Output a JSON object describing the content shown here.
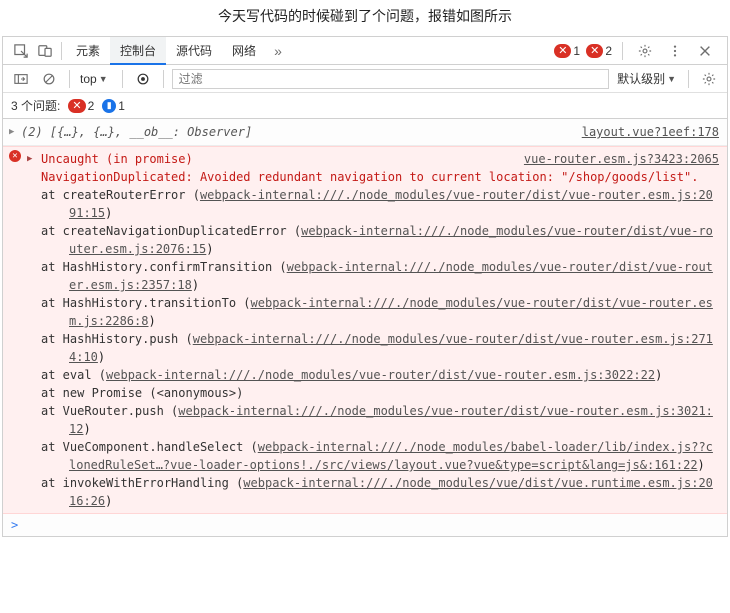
{
  "title": "今天写代码的时候碰到了个问题，报错如图所示",
  "tabs": {
    "elements": "元素",
    "console": "控制台",
    "sources": "源代码",
    "network": "网络"
  },
  "top_badges": {
    "error_count": "1",
    "warn_count": "2"
  },
  "toolbar": {
    "context": "top",
    "filter_placeholder": "过滤",
    "level": "默认级别"
  },
  "issues_bar": {
    "label": "3 个问题:",
    "err_count": "2",
    "msg_count": "1"
  },
  "log1": {
    "text": "(2) [{…}, {…}, __ob__: Observer]",
    "link": "layout.vue?1eef:178"
  },
  "error": {
    "head": "Uncaught (in promise)",
    "head_link": "vue-router.esm.js?3423:2065",
    "msg1": "NavigationDuplicated: Avoided redundant navigation to current location: \"/shop/goods/list\".",
    "stack": [
      {
        "at": "at createRouterError (",
        "link": "webpack-internal:///./node_modules/vue-router/dist/vue-router.esm.js:2091:15",
        "close": ")"
      },
      {
        "at": "at createNavigationDuplicatedError (",
        "link": "webpack-internal:///./node_modules/vue-router/dist/vue-router.esm.js:2076:15",
        "close": ")"
      },
      {
        "at": "at HashHistory.confirmTransition (",
        "link": "webpack-internal:///./node_modules/vue-router/dist/vue-router.esm.js:2357:18",
        "close": ")"
      },
      {
        "at": "at HashHistory.transitionTo (",
        "link": "webpack-internal:///./node_modules/vue-router/dist/vue-router.esm.js:2286:8",
        "close": ")"
      },
      {
        "at": "at HashHistory.push (",
        "link": "webpack-internal:///./node_modules/vue-router/dist/vue-router.esm.js:2714:10",
        "close": ")"
      },
      {
        "at": "at eval (",
        "link": "webpack-internal:///./node_modules/vue-router/dist/vue-router.esm.js:3022:22",
        "close": ")"
      },
      {
        "at": "at new Promise (<anonymous>)",
        "link": "",
        "close": ""
      },
      {
        "at": "at VueRouter.push (",
        "link": "webpack-internal:///./node_modules/vue-router/dist/vue-router.esm.js:3021:12",
        "close": ")"
      },
      {
        "at": "at VueComponent.handleSelect (",
        "link": "webpack-internal:///./node_modules/babel-loader/lib/index.js??clonedRuleSet…?vue-loader-options!./src/views/layout.vue?vue&type=script&lang=js&:161:22",
        "close": ")"
      },
      {
        "at": "at invokeWithErrorHandling (",
        "link": "webpack-internal:///./node_modules/vue/dist/vue.runtime.esm.js:2016:26",
        "close": ")"
      }
    ]
  },
  "prompt": ">"
}
